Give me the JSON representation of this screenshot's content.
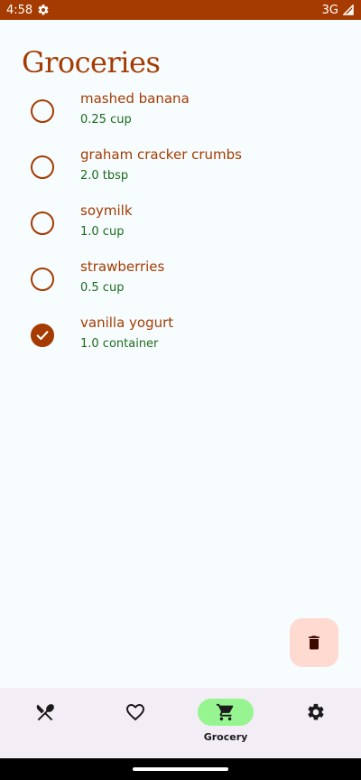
{
  "status_bar": {
    "time": "4:58",
    "network": "3G"
  },
  "page": {
    "title": "Groceries"
  },
  "items": [
    {
      "name": "mashed banana",
      "qty": "0.25 cup",
      "checked": false
    },
    {
      "name": "graham cracker crumbs",
      "qty": "2.0 tbsp",
      "checked": false
    },
    {
      "name": "soymilk",
      "qty": "1.0 cup",
      "checked": false
    },
    {
      "name": "strawberries",
      "qty": "0.5 cup",
      "checked": false
    },
    {
      "name": "vanilla yogurt",
      "qty": "1.0 container",
      "checked": true
    }
  ],
  "nav": {
    "items": [
      {
        "icon": "recipes-icon",
        "label": ""
      },
      {
        "icon": "favorites-icon",
        "label": ""
      },
      {
        "icon": "cart-icon",
        "label": "Grocery",
        "active": true
      },
      {
        "icon": "settings-icon",
        "label": ""
      }
    ]
  },
  "colors": {
    "primary": "#a53b00",
    "quantity": "#1d6b1d",
    "nav_active": "#97f591",
    "fab_bg": "#ffdad0"
  }
}
